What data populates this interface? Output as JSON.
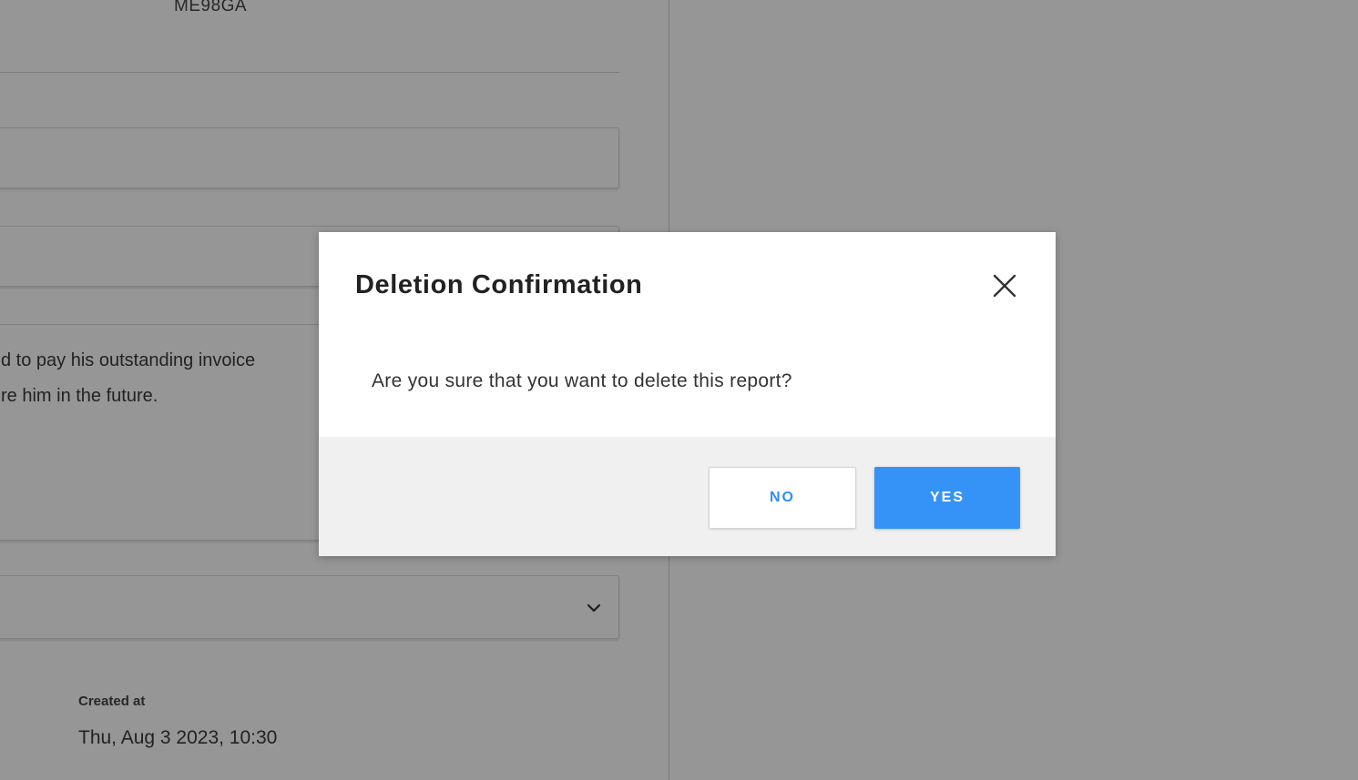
{
  "background": {
    "plate_number": "ME98GA",
    "notes_line_1": "d to pay his outstanding invoice",
    "notes_line_2": "re him in the future.",
    "created_label": "Created at",
    "created_value": "Thu, Aug 3 2023, 10:30",
    "dropdown_icon": "chevron-down-icon"
  },
  "modal": {
    "title": "Deletion Confirmation",
    "close_icon": "close-icon",
    "message": "Are you sure that you want to delete this report?",
    "no_label": "NO",
    "yes_label": "YES"
  },
  "colors": {
    "accent": "#3593f7",
    "footer_bg": "#f0f0f0",
    "overlay": "rgba(0,0,0,0.41)"
  }
}
